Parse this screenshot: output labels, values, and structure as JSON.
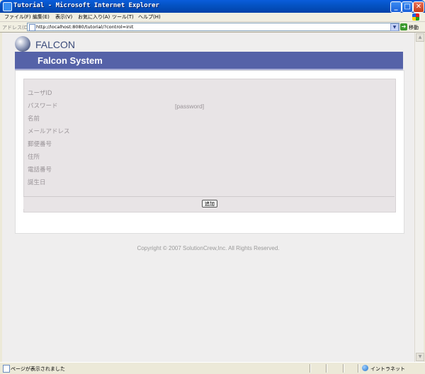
{
  "window": {
    "title": "Tutorial - Microsoft Internet Explorer",
    "minimize": "_",
    "maximize": "□",
    "close": "✕"
  },
  "menu": {
    "items": [
      "ファイル(F)",
      "編集(E)",
      "表示(V)",
      "お気に入り(A)",
      "ツール(T)",
      "ヘルプ(H)"
    ]
  },
  "address": {
    "label": "アドレス(D)",
    "url": "http://localhost:8080/tutorial/?control=init",
    "go_label": "移動"
  },
  "page": {
    "logo_text": "FALCON",
    "system_title": "Falcon System",
    "fields": [
      "ユーザID",
      "パスワード",
      "名前",
      "メールアドレス",
      "郵便番号",
      "住所",
      "電話番号",
      "誕生日"
    ],
    "password_value": "[password]",
    "add_button": "追加",
    "copyright": "Copyright © 2007 SolutionCrew,Inc. All Rights Reserved."
  },
  "status": {
    "text": "ページが表示されました",
    "zone": "イントラネット"
  }
}
